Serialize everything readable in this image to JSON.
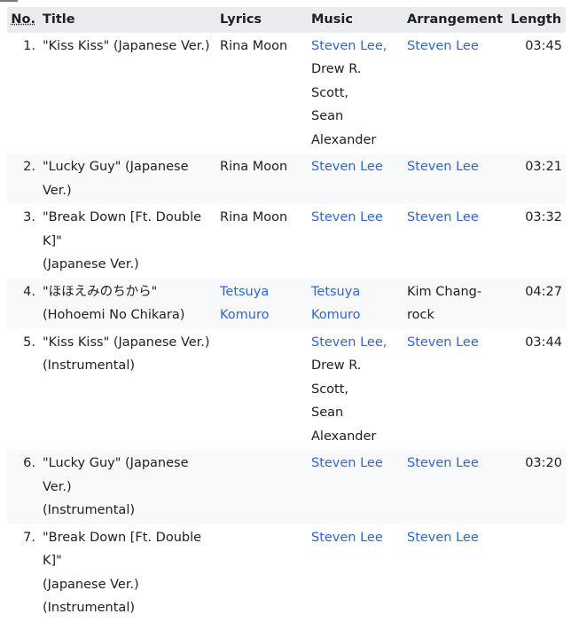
{
  "table": {
    "headers": {
      "no": "No.",
      "title": "Title",
      "lyrics": "Lyrics",
      "music": "Music",
      "arrangement": "Arrangement",
      "length": "Length"
    },
    "rows": [
      {
        "no": "1.",
        "title_lines": [
          "\"Kiss Kiss\" (Japanese Ver.)"
        ],
        "lyrics_lines": [
          "Rina Moon"
        ],
        "lyrics_linked": false,
        "music_lines": [
          "Steven Lee,",
          "Drew R. Scott,",
          "Sean",
          "Alexander"
        ],
        "music_linked": [
          true,
          false,
          false,
          false
        ],
        "arrangement": "Steven Lee",
        "length": "03:45"
      },
      {
        "no": "2.",
        "title_lines": [
          "\"Lucky Guy\" (Japanese Ver.)"
        ],
        "lyrics_lines": [
          "Rina Moon"
        ],
        "lyrics_linked": false,
        "music_lines": [
          "Steven Lee"
        ],
        "music_linked": [
          true
        ],
        "arrangement": "Steven Lee",
        "length": "03:21"
      },
      {
        "no": "3.",
        "title_lines": [
          "\"Break Down [Ft. Double K]\"",
          "(Japanese Ver.)"
        ],
        "lyrics_lines": [
          "Rina Moon"
        ],
        "lyrics_linked": false,
        "music_lines": [
          "Steven Lee"
        ],
        "music_linked": [
          true
        ],
        "arrangement": "Steven Lee",
        "length": "03:32"
      },
      {
        "no": "4.",
        "title_lines": [
          "\"ほほえみのちから\"",
          "(Hohoemi No Chikara)"
        ],
        "lyrics_lines": [
          "Tetsuya",
          "Komuro"
        ],
        "lyrics_linked": true,
        "music_lines": [
          "Tetsuya",
          "Komuro"
        ],
        "music_linked": [
          true,
          true
        ],
        "arrangement": "Kim Chang-rock",
        "arrangement_plain": true,
        "length": "04:27"
      },
      {
        "no": "5.",
        "title_lines": [
          "\"Kiss Kiss\" (Japanese Ver.)",
          "(Instrumental)"
        ],
        "lyrics_lines": [],
        "lyrics_linked": false,
        "music_lines": [
          "Steven Lee,",
          "Drew R. Scott,",
          "Sean",
          "Alexander"
        ],
        "music_linked": [
          true,
          false,
          false,
          false
        ],
        "arrangement": "Steven Lee",
        "length": "03:44"
      },
      {
        "no": "6.",
        "title_lines": [
          "\"Lucky Guy\" (Japanese Ver.)",
          "(Instrumental)"
        ],
        "lyrics_lines": [],
        "lyrics_linked": false,
        "music_lines": [
          "Steven Lee"
        ],
        "music_linked": [
          true
        ],
        "arrangement": "Steven Lee",
        "length": "03:20"
      },
      {
        "no": "7.",
        "title_lines": [
          "\"Break Down [Ft. Double K]\"",
          "(Japanese Ver.)",
          "(Instrumental)"
        ],
        "lyrics_lines": [],
        "lyrics_linked": false,
        "music_lines": [
          "Steven Lee"
        ],
        "music_linked": [
          true
        ],
        "arrangement": "Steven Lee",
        "length": ""
      }
    ]
  }
}
